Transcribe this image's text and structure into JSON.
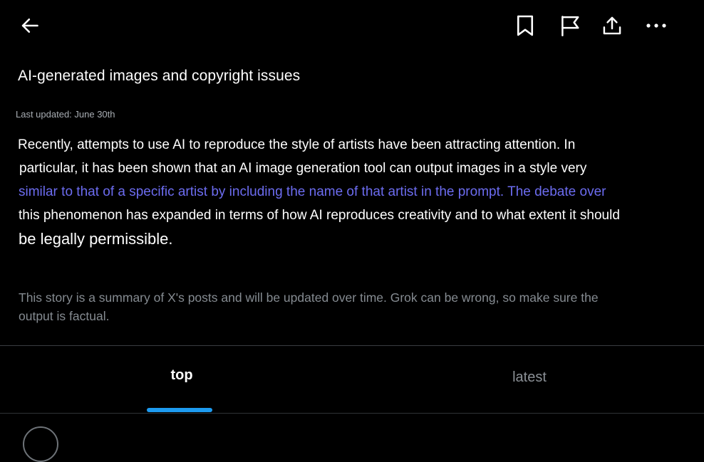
{
  "header": {
    "back_icon": "arrow-left-icon",
    "bookmark_icon": "bookmark-icon",
    "flag_icon": "flag-icon",
    "share_icon": "share-upload-icon",
    "more_icon": "more-horizontal-icon"
  },
  "story": {
    "title": "AI-generated images and copyright issues",
    "last_updated": "Last updated: June 30th",
    "body_lines": [
      "Recently, attempts to use AI to reproduce the style of artists have been attracting attention. In",
      "particular, it has been shown that an AI image generation tool can output images in a style very",
      "similar to that of a specific artist by including the name of that artist in the prompt. The debate over",
      "this phenomenon has expanded in terms of how AI reproduces creativity and to what extent it should",
      "be legally permissible."
    ],
    "disclaimer_lines": [
      "This story is a summary of X's posts and will be updated over time. Grok can be wrong, so make sure the",
      "output is factual."
    ]
  },
  "tabs": [
    {
      "label": "top",
      "active": true
    },
    {
      "label": "latest",
      "active": false
    }
  ],
  "colors": {
    "background": "#000000",
    "accent": "#1d9bf0",
    "link_text": "#6c6cf0",
    "muted_text": "#858b91"
  }
}
